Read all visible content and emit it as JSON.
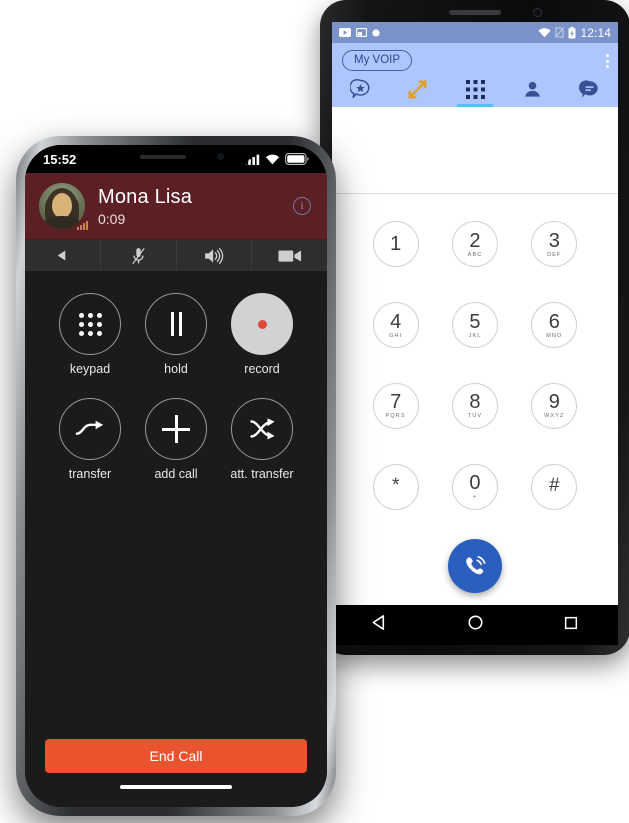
{
  "iphone": {
    "status_bar": {
      "time": "15:52",
      "signal_icon": "cellular-bars-icon",
      "wifi_icon": "wifi-icon",
      "battery_icon": "battery-icon"
    },
    "call_header": {
      "contact_name": "Mona Lisa",
      "call_duration": "0:09",
      "avatar_name": "mona-lisa-avatar",
      "info_label": "i",
      "background_color": "#5c1f24"
    },
    "toolbar": [
      {
        "name": "back-icon",
        "label": "back"
      },
      {
        "name": "mic-muted-icon",
        "label": "mute"
      },
      {
        "name": "speaker-icon",
        "label": "speaker"
      },
      {
        "name": "video-camera-icon",
        "label": "video"
      }
    ],
    "controls": [
      {
        "label": "keypad",
        "icon": "keypad-icon",
        "active": false
      },
      {
        "label": "hold",
        "icon": "pause-icon",
        "active": false
      },
      {
        "label": "record",
        "icon": "record-dot-icon",
        "active": true
      },
      {
        "label": "transfer",
        "icon": "transfer-arrow-icon",
        "active": false
      },
      {
        "label": "add call",
        "icon": "plus-icon",
        "active": false
      },
      {
        "label": "att. transfer",
        "icon": "attended-transfer-icon",
        "active": false
      }
    ],
    "end_call": {
      "label": "End Call",
      "color": "#e9542f"
    }
  },
  "android": {
    "status_bar": {
      "time": "12:14",
      "left_icons": [
        "youtube-icon",
        "picture-in-picture-icon",
        "dot-icon"
      ],
      "right_icons": [
        "wifi-icon",
        "no-sim-icon",
        "battery-charging-icon"
      ],
      "background_color": "#7b93c9"
    },
    "app_bar": {
      "account_chip": "My VOIP",
      "overflow_icon": "overflow-menu-icon",
      "background_color": "#aec6fb"
    },
    "tabs": [
      {
        "name": "tab-favorites",
        "icon": "favorites-star-bubble-icon",
        "active": false
      },
      {
        "name": "tab-call-history",
        "icon": "call-history-arrows-icon",
        "active": false
      },
      {
        "name": "tab-keypad",
        "icon": "keypad-grid-icon",
        "active": true
      },
      {
        "name": "tab-contacts",
        "icon": "contacts-person-icon",
        "active": false
      },
      {
        "name": "tab-messages",
        "icon": "messages-bubble-icon",
        "active": false
      }
    ],
    "dial_input": {
      "value": "",
      "placeholder": ""
    },
    "dialpad": [
      {
        "digit": "1",
        "letters": ""
      },
      {
        "digit": "2",
        "letters": "ABC"
      },
      {
        "digit": "3",
        "letters": "DEF"
      },
      {
        "digit": "4",
        "letters": "GHI"
      },
      {
        "digit": "5",
        "letters": "JKL"
      },
      {
        "digit": "6",
        "letters": "MNO"
      },
      {
        "digit": "7",
        "letters": "PQRS"
      },
      {
        "digit": "8",
        "letters": "TUV"
      },
      {
        "digit": "9",
        "letters": "WXYZ"
      },
      {
        "digit": "*",
        "letters": ""
      },
      {
        "digit": "0",
        "letters": "+"
      },
      {
        "digit": "#",
        "letters": ""
      }
    ],
    "call_button": {
      "icon": "phone-call-icon",
      "color": "#2a5fc0"
    },
    "nav_bar": [
      {
        "name": "nav-back",
        "icon": "triangle-back-icon"
      },
      {
        "name": "nav-home",
        "icon": "circle-home-icon"
      },
      {
        "name": "nav-recents",
        "icon": "square-recents-icon"
      }
    ]
  }
}
